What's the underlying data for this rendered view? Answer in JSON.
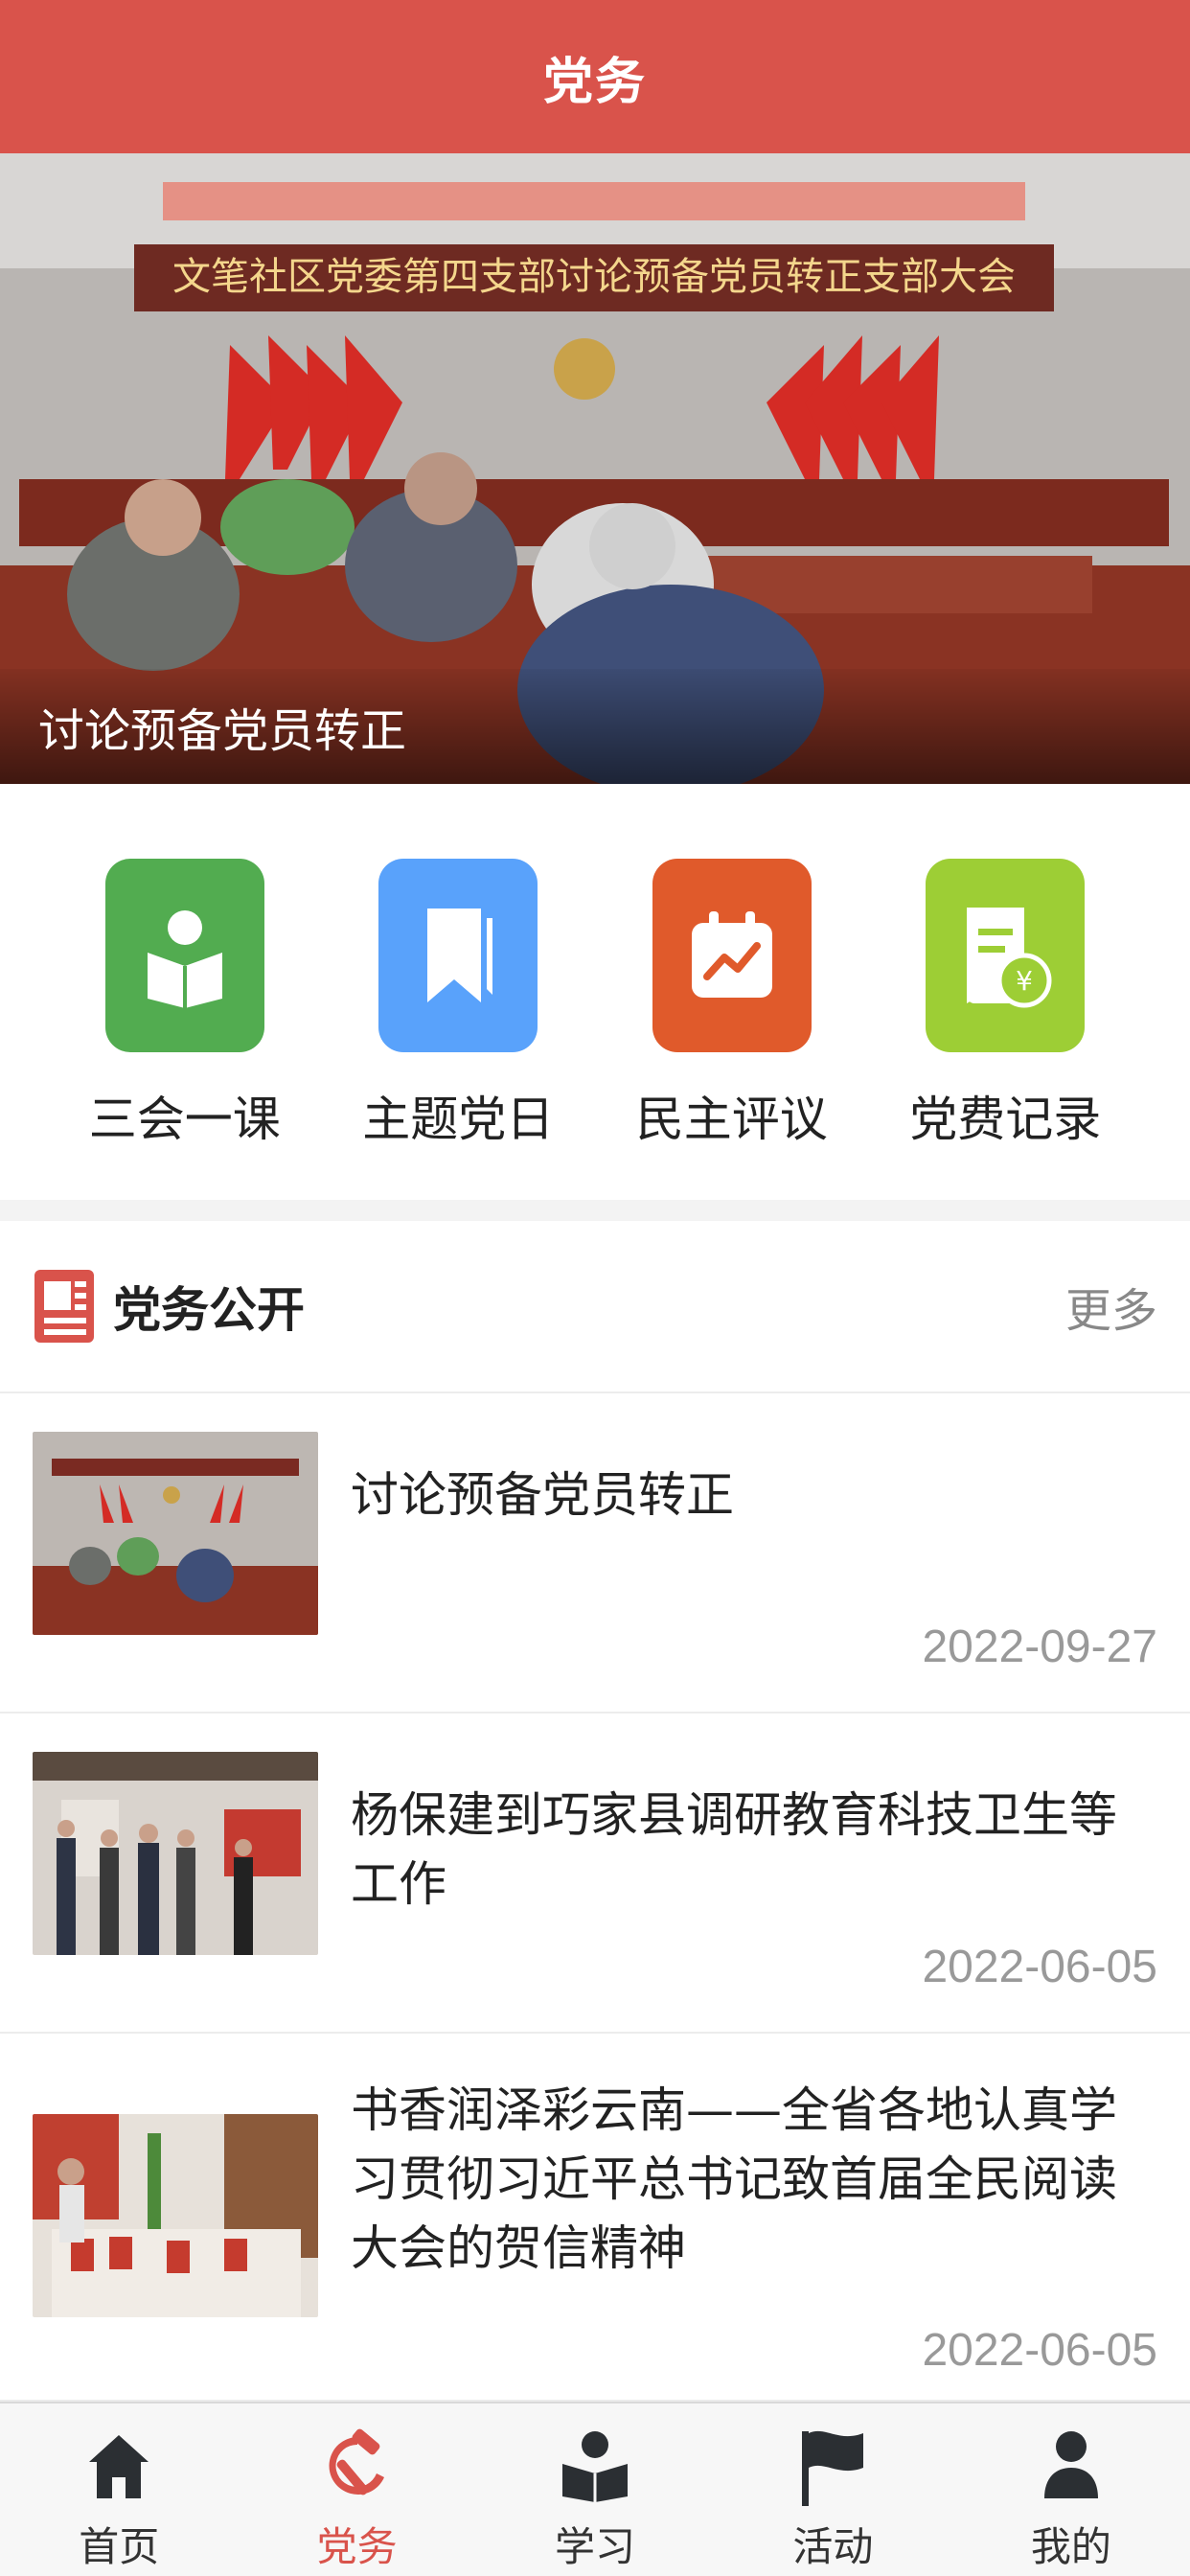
{
  "header": {
    "title": "党务"
  },
  "banner": {
    "caption": "讨论预备党员转正",
    "photo_text": "文笔社区党委第四支部讨论预备党员转正支部大会"
  },
  "quick_entries": [
    {
      "label": "三会一课",
      "icon": "reading-person-icon",
      "color": "#52ac50"
    },
    {
      "label": "主题党日",
      "icon": "bookmark-icon",
      "color": "#59a2fb"
    },
    {
      "label": "民主评议",
      "icon": "calendar-chart-icon",
      "color": "#e05a2b"
    },
    {
      "label": "党费记录",
      "icon": "receipt-yen-icon",
      "color": "#9dce35"
    }
  ],
  "section": {
    "title": "党务公开",
    "more": "更多",
    "icon": "newspaper-icon",
    "accent": "#d9534b"
  },
  "news": [
    {
      "title": "讨论预备党员转正",
      "date": "2022-09-27"
    },
    {
      "title": "杨保建到巧家县调研教育科技卫生等工作",
      "date": "2022-06-05"
    },
    {
      "title": "书香润泽彩云南——全省各地认真学习贯彻习近平总书记致首届全民阅读大会的贺信精神",
      "date": "2022-06-05"
    }
  ],
  "tabbar": [
    {
      "label": "首页",
      "icon": "home-icon"
    },
    {
      "label": "党务",
      "icon": "party-emblem-icon",
      "active": true
    },
    {
      "label": "学习",
      "icon": "study-icon"
    },
    {
      "label": "活动",
      "icon": "flag-icon"
    },
    {
      "label": "我的",
      "icon": "user-icon"
    }
  ],
  "colors": {
    "header": "#d9534b",
    "active_tab": "#d9534b"
  }
}
